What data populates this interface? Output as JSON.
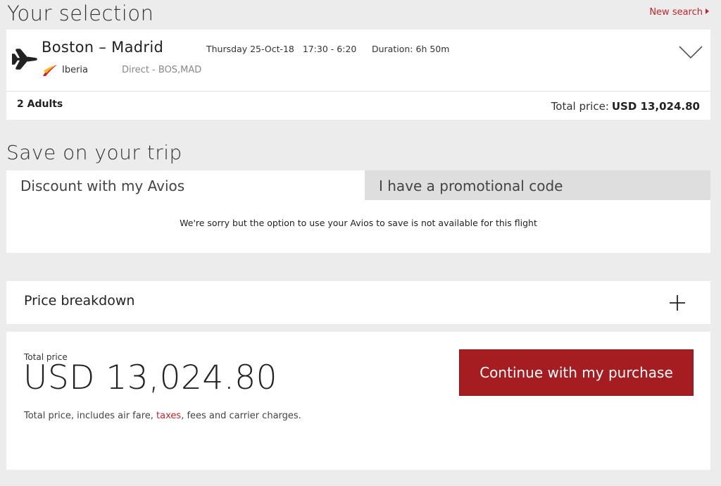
{
  "header": {
    "title": "Your selection",
    "new_search": "New search"
  },
  "flight": {
    "origin": "Boston",
    "separator": "–",
    "destination": "Madrid",
    "date": "Thursday 25-Oct-18",
    "times": "17:30 - 6:20",
    "duration_label": "Duration:",
    "duration": "6h 50m",
    "airline": "Iberia",
    "type": "Direct - BOS,MAD",
    "passengers": "2 Adults",
    "total_label": "Total price:",
    "total_amount": "USD 13,024.80"
  },
  "save": {
    "title": "Save on your trip",
    "tabs": [
      {
        "label": "Discount with my Avios",
        "active": true
      },
      {
        "label": "I have a promotional code",
        "active": false
      }
    ],
    "message": "We're sorry but the option to use your Avios to save is not available for this flight"
  },
  "breakdown": {
    "label": "Price breakdown",
    "icon": "plus-icon"
  },
  "purchase": {
    "total_label": "Total price",
    "total_amount": "USD 13,024.80",
    "note_before": "Total price, includes air fare, ",
    "note_link": "taxes",
    "note_after": ", fees and carrier charges.",
    "button": "Continue with my purchase"
  },
  "colors": {
    "accent": "#c0262d",
    "button": "#a51d20",
    "background": "#ececec",
    "tab_inactive": "#dedede"
  }
}
